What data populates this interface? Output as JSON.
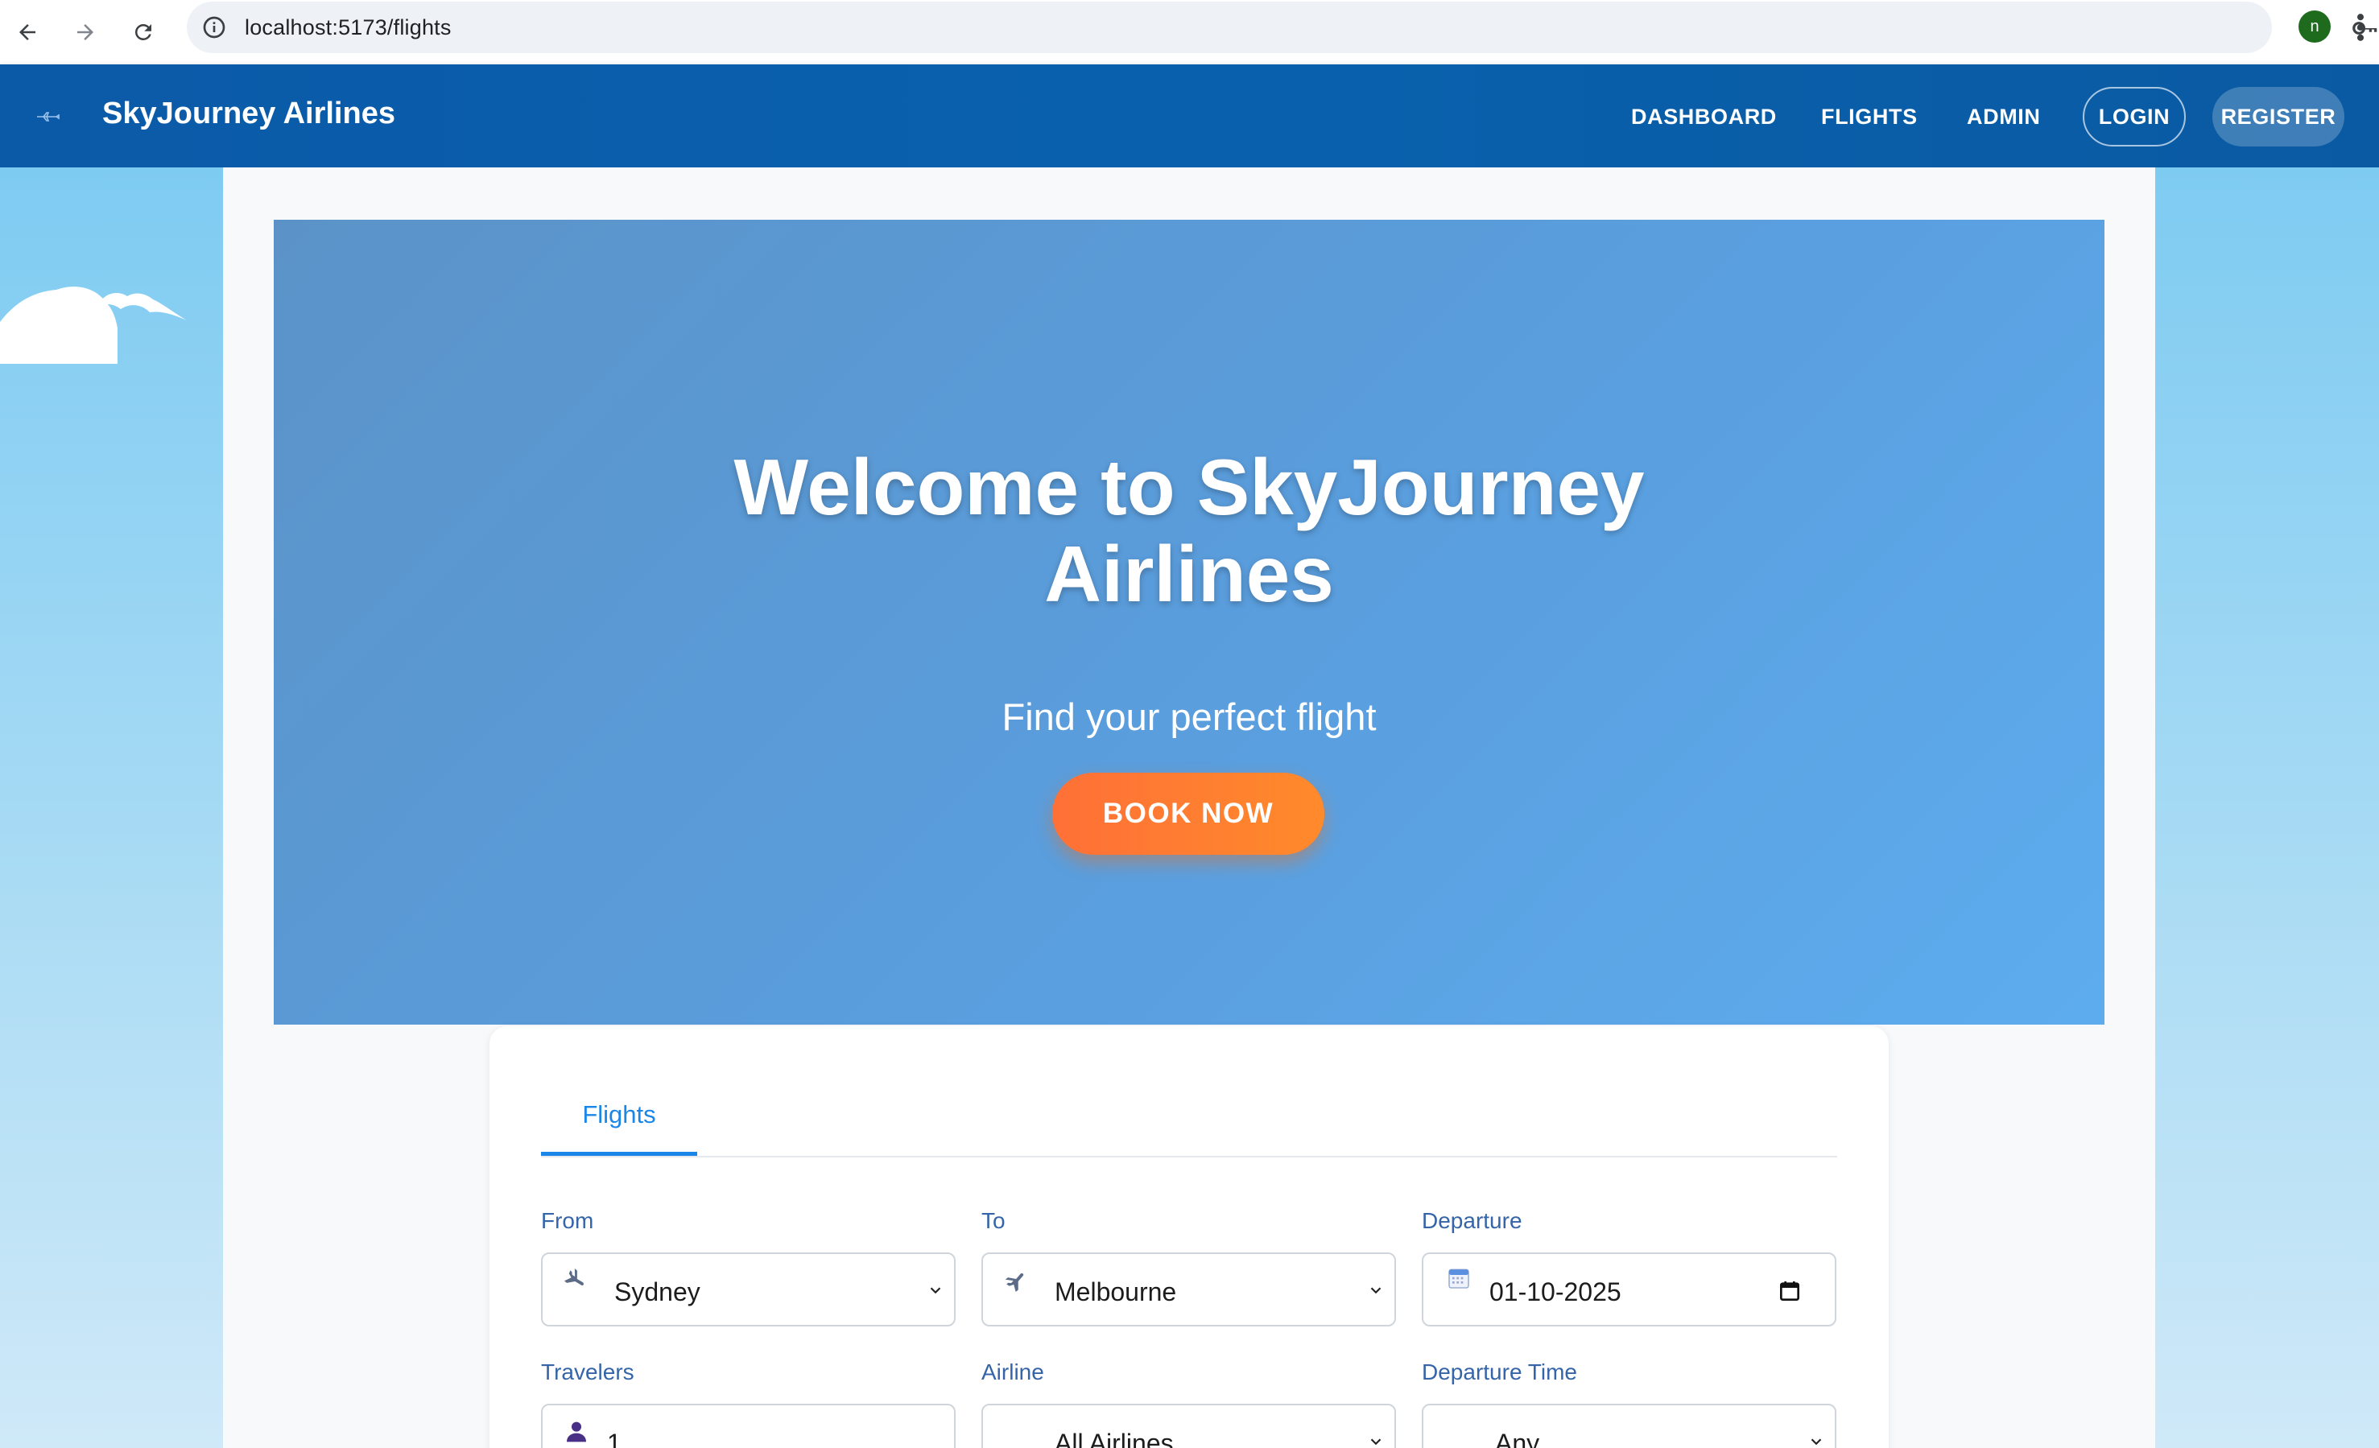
{
  "browser": {
    "url": "localhost:5173/flights",
    "profile_initial": "n"
  },
  "appbar": {
    "brand": "SkyJourney Airlines",
    "nav": {
      "dashboard": "DASHBOARD",
      "flights": "FLIGHTS",
      "admin": "ADMIN",
      "login": "LOGIN",
      "register": "REGISTER"
    }
  },
  "hero": {
    "title_line1": "Welcome to SkyJourney",
    "title_line2": "Airlines",
    "subtitle": "Find your perfect flight",
    "cta": "BOOK NOW"
  },
  "search": {
    "tab": "Flights",
    "from": {
      "label": "From",
      "value": "Sydney",
      "icon": "plane-takeoff-icon"
    },
    "to": {
      "label": "To",
      "value": "Melbourne",
      "icon": "plane-landing-icon"
    },
    "departure": {
      "label": "Departure",
      "value": "01-10-2025",
      "icon": "calendar-icon"
    },
    "travelers": {
      "label": "Travelers",
      "value": "1",
      "icon": "person-icon"
    },
    "airline": {
      "label": "Airline",
      "value": "All Airlines"
    },
    "departure_time": {
      "label": "Departure Time",
      "value": "Any"
    }
  },
  "colors": {
    "appbar": "#0961ad",
    "accent": "#1a86e8",
    "cta": "#ff7a33",
    "label": "#3565a8"
  }
}
